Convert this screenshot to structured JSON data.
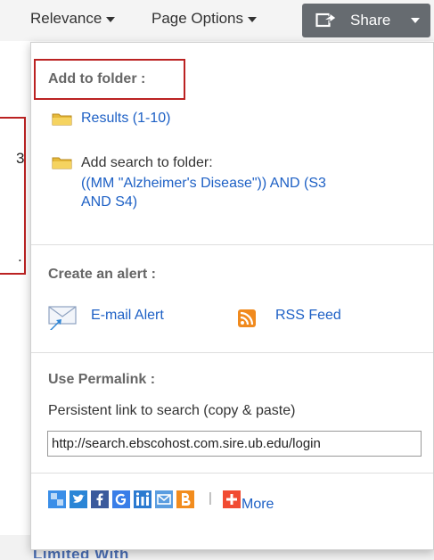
{
  "toolbar": {
    "relevance_label": "Relevance",
    "page_options_label": "Page Options",
    "share_label": "Share"
  },
  "share_menu": {
    "add_to_folder": {
      "title": "Add to folder :",
      "results_link": "Results (1-10)",
      "add_search_label": "Add search to folder:",
      "search_query_line1": "((MM \"Alzheimer's Disease\")) AND (S3",
      "search_query_line2": "AND S4)"
    },
    "create_alert": {
      "title": "Create an alert :",
      "email_alert": "E-mail Alert",
      "rss_feed": "RSS Feed"
    },
    "permalink": {
      "title": "Use Permalink :",
      "description": "Persistent link to search (copy & paste)",
      "url": "http://search.ebscohost.com.sire.ub.edu/login"
    },
    "social": {
      "separator": "|",
      "more_label": "More",
      "icons": [
        "delicious-icon",
        "twitter-icon",
        "facebook-icon",
        "google-icon",
        "mendeley-icon",
        "email-icon",
        "blogger-icon",
        "addthis-plus-icon"
      ],
      "colors": {
        "delicious": "#3a8ee8",
        "twitter": "#2a85d6",
        "facebook": "#3b5a9c",
        "google": "#3a7ee8",
        "mendeley": "#2b7ad0",
        "email": "#5a9de0",
        "blogger": "#f28c1e",
        "addthis": "#f14b32"
      }
    }
  },
  "background": {
    "fragment1": "3",
    "fragment2": ".",
    "bottom_text": "Limited With"
  },
  "colors": {
    "link": "#1d60c5",
    "highlight_border": "#b22222",
    "share_button_bg": "#666b70"
  }
}
